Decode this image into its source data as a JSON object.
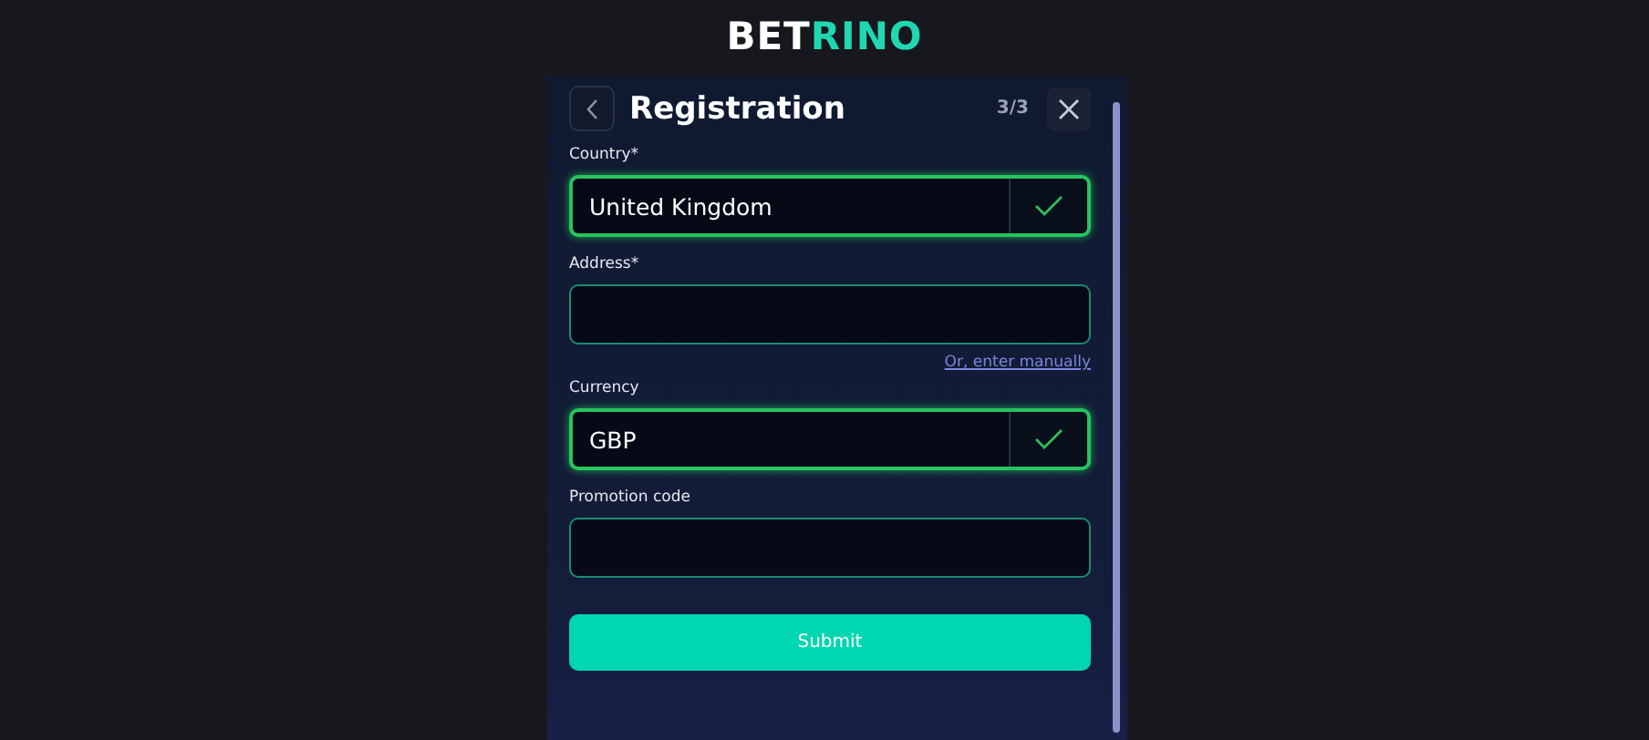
{
  "logo": {
    "text": "BET",
    "accent": "RINO"
  },
  "header": {
    "title": "Registration",
    "step": "3/3"
  },
  "fields": [
    {
      "label": "Country*",
      "value": "United Kingdom",
      "valid": true
    },
    {
      "label": "Address*",
      "valid": false,
      "link": "Or, enter manually"
    },
    {
      "label": "Currency",
      "value": "GBP",
      "valid": true
    },
    {
      "label": "Promotion code",
      "valid": false
    }
  ],
  "submit": "Submit"
}
